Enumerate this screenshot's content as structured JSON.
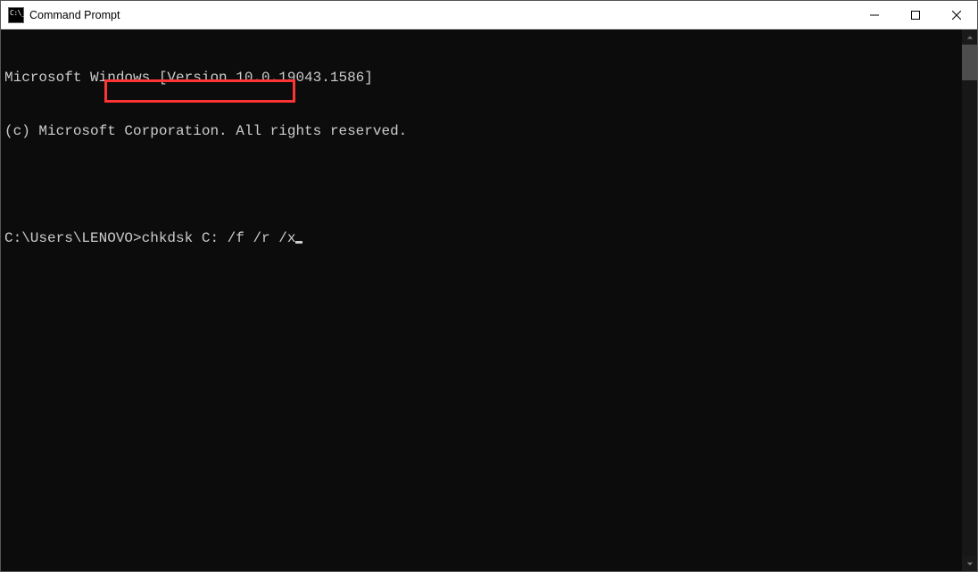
{
  "window": {
    "title": "Command Prompt"
  },
  "terminal": {
    "line1": "Microsoft Windows [Version 10.0.19043.1586]",
    "line2": "(c) Microsoft Corporation. All rights reserved.",
    "blank": "",
    "prompt": "C:\\Users\\LENOVO>",
    "command": "chkdsk C: /f /r /x"
  }
}
